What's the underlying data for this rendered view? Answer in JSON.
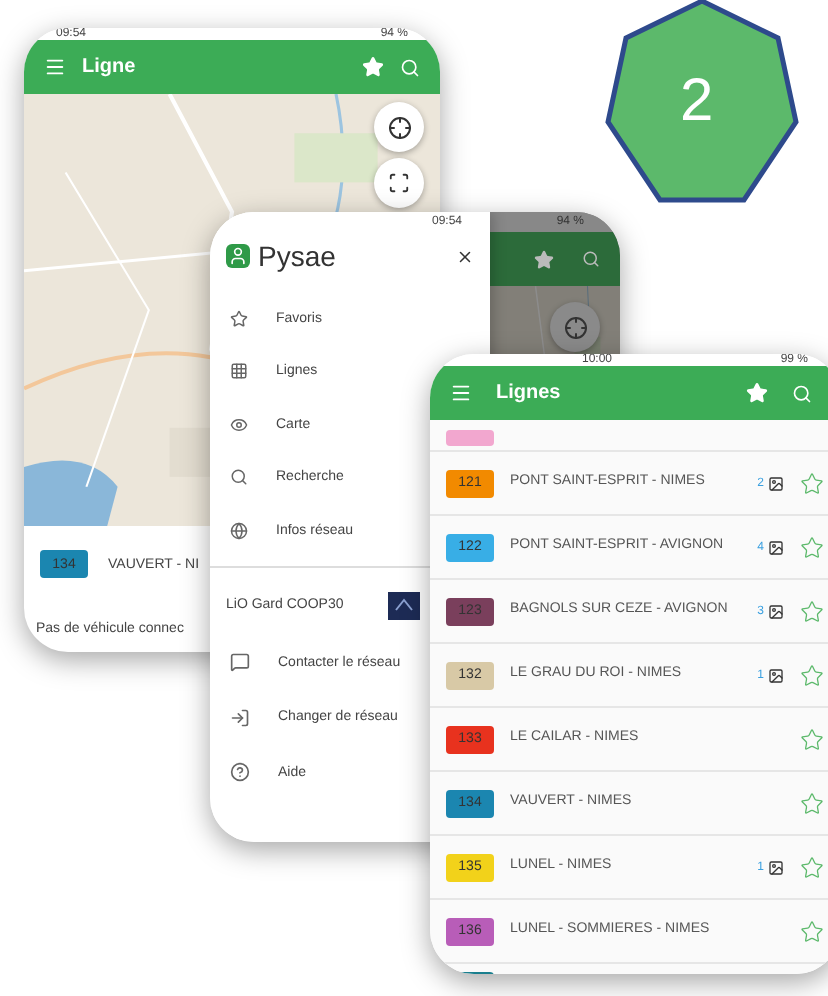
{
  "badge": {
    "label": "2"
  },
  "map_screen": {
    "status": {
      "time": "09:54",
      "battery": "94 %"
    },
    "title": "Ligne",
    "line": {
      "number": "134",
      "color": "#1b86b0",
      "name": "VAUVERT - NI"
    },
    "message": "Pas de véhicule connec"
  },
  "menu_screen": {
    "status": {
      "time": "09:54",
      "battery": "94 %"
    },
    "app_name": "Pysae",
    "items": [
      {
        "label": "Favoris"
      },
      {
        "label": "Lignes"
      },
      {
        "label": "Carte"
      },
      {
        "label": "Recherche"
      },
      {
        "label": "Infos réseau"
      }
    ],
    "network": {
      "name": "LiO Gard COOP30"
    },
    "actions": [
      {
        "label": "Contacter le réseau"
      },
      {
        "label": "Changer de réseau"
      },
      {
        "label": "Aide"
      }
    ]
  },
  "lines_screen": {
    "status": {
      "time": "10:00",
      "battery": "99 %"
    },
    "title": "Lignes",
    "lines": [
      {
        "kind": "partial",
        "color": "#f2a7cf"
      },
      {
        "kind": "line",
        "number": "121",
        "color": "#f28a00",
        "name": "PONT SAINT-ESPRIT - NIMES",
        "count": "2"
      },
      {
        "kind": "line",
        "number": "122",
        "color": "#38aee6",
        "name": "PONT SAINT-ESPRIT - AVIGNON",
        "count": "4"
      },
      {
        "kind": "line",
        "number": "123",
        "color": "#7a3f5c",
        "name": "BAGNOLS SUR CEZE - AVIGNON",
        "count": "3"
      },
      {
        "kind": "line",
        "number": "132",
        "color": "#d8c9a6",
        "name": "LE GRAU DU ROI - NIMES",
        "count": "1"
      },
      {
        "kind": "line",
        "number": "133",
        "color": "#e8321e",
        "name": "LE CAILAR - NIMES"
      },
      {
        "kind": "line",
        "number": "134",
        "color": "#1b86b0",
        "name": "VAUVERT - NIMES"
      },
      {
        "kind": "line",
        "number": "135",
        "color": "#f2d21a",
        "name": "LUNEL - NIMES",
        "count": "1"
      },
      {
        "kind": "line",
        "number": "136",
        "color": "#b85db8",
        "name": "LUNEL - SOMMIERES - NIMES"
      },
      {
        "kind": "partial",
        "color": "#1a7f8e"
      }
    ]
  }
}
